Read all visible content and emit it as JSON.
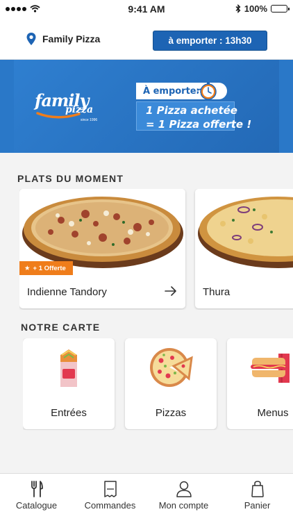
{
  "status_bar": {
    "time": "9:41 AM",
    "battery": "100%"
  },
  "header": {
    "location": "Family Pizza",
    "pickup_button": "à emporter : 13h30"
  },
  "banner": {
    "logo_text": "family pizza",
    "tag": "À emporter",
    "promo_line1": "1 Pizza achetée",
    "promo_line2": "= 1 Pizza offerte !",
    "colors": {
      "background": "#2a78c8",
      "tag_text": "#1d64b4"
    }
  },
  "plats_du_moment": {
    "title": "PLATS DU MOMENT",
    "items": [
      {
        "name": "Indienne Tandory",
        "badge": "+ 1 Offerte"
      },
      {
        "name": "Thura"
      }
    ]
  },
  "notre_carte": {
    "title": "NOTRE CARTE",
    "categories": [
      {
        "label": "Entrées",
        "icon": "wrap-icon"
      },
      {
        "label": "Pizzas",
        "icon": "pizza-icon"
      },
      {
        "label": "Menus",
        "icon": "hotdog-icon"
      }
    ]
  },
  "tab_bar": {
    "items": [
      {
        "label": "Catalogue",
        "icon": "fork-knife-icon"
      },
      {
        "label": "Commandes",
        "icon": "receipt-icon"
      },
      {
        "label": "Mon compte",
        "icon": "user-icon"
      },
      {
        "label": "Panier",
        "icon": "bag-icon"
      }
    ]
  },
  "colors": {
    "accent": "#1d64b4",
    "offer": "#ef7d1b",
    "background": "#f3f3f3"
  }
}
